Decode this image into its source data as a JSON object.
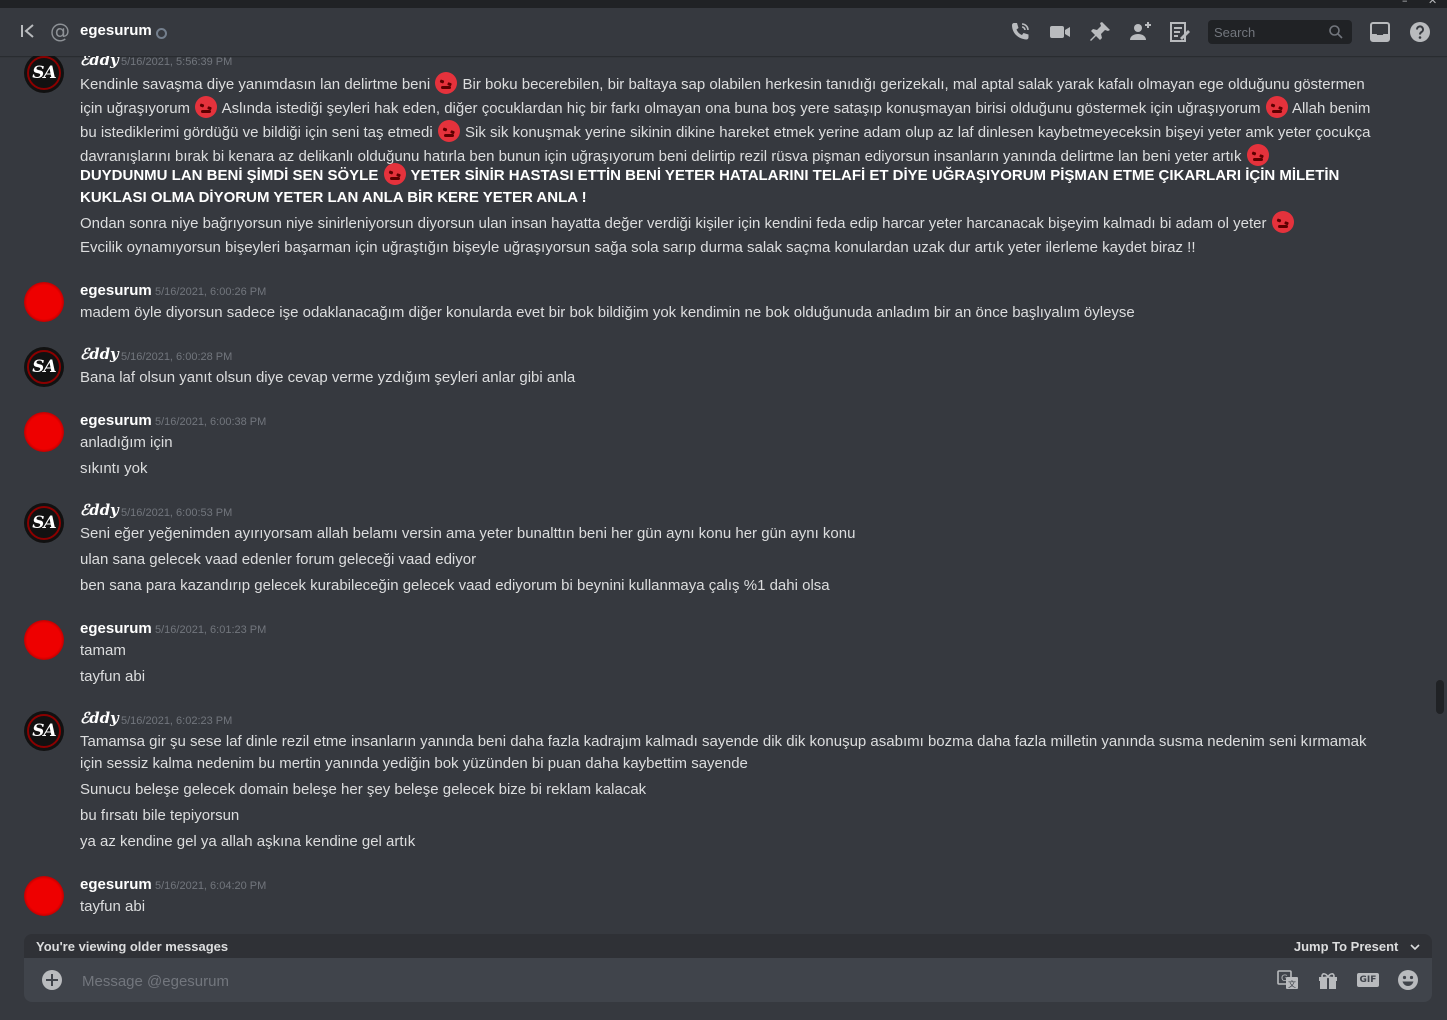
{
  "window": {
    "minimize": "–",
    "close": "✕"
  },
  "header": {
    "back_icon": "collapse-sidebar-icon",
    "at_icon": "@",
    "username": "egesurum",
    "status": "offline",
    "search_placeholder": "Search",
    "icons": [
      "call-icon",
      "video-icon",
      "pin-icon",
      "add-friend-icon",
      "profile-icon",
      "inbox-icon",
      "help-icon"
    ]
  },
  "messages": [
    {
      "author": "ℰddy",
      "timestamp": "5/16/2021, 5:56:39 PM",
      "avatar": "sa-logo",
      "lines": [
        {
          "text": "Kendinle savaşma diye yanımdasın lan delirtme beni",
          "emoji_after": true,
          "cont": "Bir boku becerebilen, bir baltaya sap olabilen herkesin tanıdığı gerizekalı, mal aptal salak yarak kafalı olmayan ege olduğunu göstermen için uğraşıyorum",
          "emoji2": true,
          "cont2": "Aslında istediği şeyleri hak eden, diğer çocuklardan hiç bir farkı olmayan  ona buna boş yere sataşıp konuşmayan birisi olduğunu göstermek için uğraşıyorum",
          "emoji3": true,
          "cont3": "Allah benim bu istediklerimi gördüğü ve bildiği için seni taş etmedi",
          "emoji4": true,
          "cont4": "Sik sik konuşmak yerine sikinin dikine hareket etmek yerine adam olup az laf dinlesen kaybetmeyeceksin bişeyi yeter amk yeter çocukça davranışlarını bırak bi kenara az delikanlı olduğunu hatırla ben bunun için uğraşıyorum beni delirtip rezil rüsva pişman ediyorsun insanların yanında delirtme lan beni yeter artık"
        },
        {
          "text": "DUYDUNMU LAN BENİ ŞİMDİ SEN SÖYLE",
          "cont": "YETER SİNİR HASTASI ETTİN BENİ YETER HATALARINI TELAFİ ET DİYE UĞRAŞIYORUM PİŞMAN ETME ÇIKARLARI İÇİN MİLETİN KUKLASI OLMA DİYORUM YETER LAN ANLA BİR KERE YETER ANLA !"
        },
        {
          "text": "Ondan sonra niye bağrıyorsun niye sinirleniyorsun diyorsun ulan insan hayatta değer verdiği kişiler için kendini feda edip harcar yeter harcanacak bişeyim kalmadı bi adam ol yeter"
        },
        {
          "text": "Evcilik oynamıyorsun bişeyleri başarman için uğraştığın bişeyle uğraşıyorsun sağa sola sarıp durma salak saçma konulardan uzak dur artık yeter ilerleme kaydet biraz !!"
        }
      ]
    },
    {
      "author": "egesurum",
      "timestamp": "5/16/2021, 6:00:26 PM",
      "avatar": "red-circle",
      "lines": [
        {
          "text": "madem öyle diyorsun sadece işe odaklanacağım diğer konularda evet bir bok bildiğim yok kendimin ne bok olduğunuda anladım bir an  önce başlıyalım öyleyse"
        }
      ]
    },
    {
      "author": "ℰddy",
      "timestamp": "5/16/2021, 6:00:28 PM",
      "avatar": "sa-logo",
      "lines": [
        {
          "text": "Bana laf olsun yanıt olsun diye cevap verme yzdığım şeyleri anlar gibi anla"
        }
      ]
    },
    {
      "author": "egesurum",
      "timestamp": "5/16/2021, 6:00:38 PM",
      "avatar": "red-circle",
      "lines": [
        {
          "text": "anladığım için"
        },
        {
          "text": "sıkıntı yok"
        }
      ]
    },
    {
      "author": "ℰddy",
      "timestamp": "5/16/2021, 6:00:53 PM",
      "avatar": "sa-logo",
      "lines": [
        {
          "text": "Seni eğer yeğenimden ayırıyorsam allah belamı versin ama yeter bunalttın beni her gün aynı konu her gün aynı konu"
        },
        {
          "text": "ulan sana gelecek vaad edenler forum geleceği vaad ediyor"
        },
        {
          "text": "ben sana para kazandırıp gelecek kurabileceğin gelecek vaad ediyorum bi beynini kullanmaya çalış %1 dahi olsa"
        }
      ]
    },
    {
      "author": "egesurum",
      "timestamp": "5/16/2021, 6:01:23 PM",
      "avatar": "red-circle",
      "lines": [
        {
          "text": "tamam"
        },
        {
          "text": "tayfun abi"
        }
      ]
    },
    {
      "author": "ℰddy",
      "timestamp": "5/16/2021, 6:02:23 PM",
      "avatar": "sa-logo",
      "lines": [
        {
          "text": "Tamamsa gir şu sese laf dinle rezil etme insanların yanında beni daha fazla kadrajım kalmadı sayende dik dik konuşup asabımı bozma daha fazla milletin yanında susma nedenim seni kırmamak için sessiz kalma nedenim bu mertin yanında yediğin bok yüzünden bi puan daha kaybettim sayende"
        },
        {
          "text": "Sunucu beleşe gelecek domain beleşe her şey beleşe gelecek bize bi reklam kalacak"
        },
        {
          "text": "bu fırsatı bile tepiyorsun"
        },
        {
          "text": "ya az kendine gel ya allah aşkına kendine gel artık"
        }
      ]
    },
    {
      "author": "egesurum",
      "timestamp": "5/16/2021, 6:04:20 PM",
      "avatar": "red-circle",
      "lines": [
        {
          "text": "tayfun abi"
        }
      ]
    }
  ],
  "older_bar": {
    "label": "You're viewing older messages",
    "jump_label": "Jump To Present"
  },
  "composer": {
    "placeholder": "Message @egesurum",
    "icons": [
      "translate-icon",
      "gift-icon",
      "gif-icon",
      "emoji-icon"
    ],
    "gif_label": "GIF"
  },
  "colors": {
    "background": "#36393f",
    "sidebar": "#202225",
    "composer": "#40444b",
    "text": "#dcddde",
    "muted": "#72767d"
  }
}
